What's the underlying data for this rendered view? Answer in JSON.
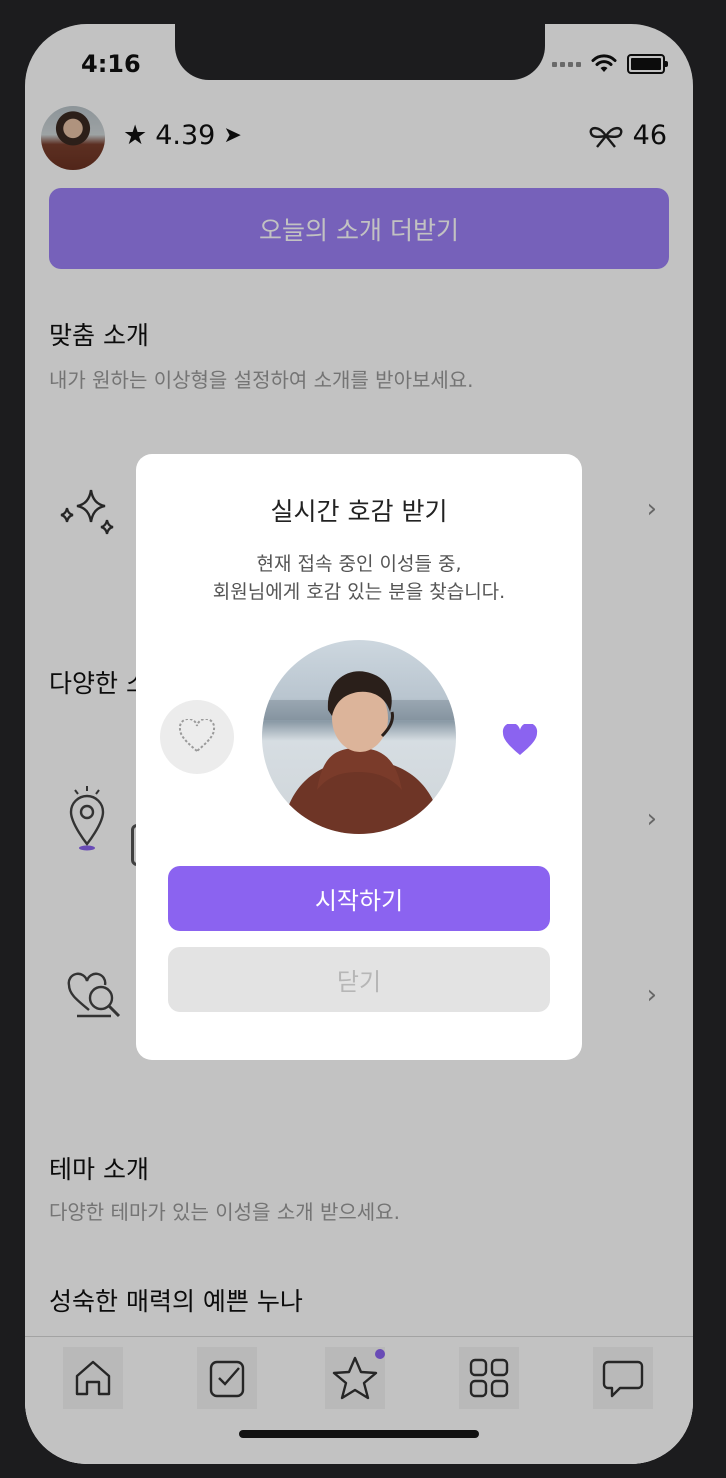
{
  "status_bar": {
    "time": "4:16"
  },
  "header": {
    "rating": "4.39",
    "ticket_count": "46"
  },
  "more_intro_button": "오늘의 소개 더받기",
  "sections": {
    "custom": {
      "title": "맞춤 소개",
      "subtitle": "내가 원하는 이상형을 설정하여 소개를 받아보세요."
    },
    "various": {
      "title_partial": "다양한 소"
    },
    "theme": {
      "title": "테마 소개",
      "subtitle": "다양한 테마가 있는 이성을 소개 받으세요."
    },
    "theme_item": {
      "title": "성숙한 매력의 예쁜 누나"
    }
  },
  "modal": {
    "title": "실시간 호감 받기",
    "desc_line1": "현재 접속 중인 이성들 중,",
    "desc_line2": "회원님에게 호감 있는 분을 찾습니다.",
    "start_button": "시작하기",
    "close_button": "닫기"
  },
  "colors": {
    "accent": "#8b63f0",
    "accent_light": "#9b80f5",
    "overlay": "rgba(0,0,0,0.24)"
  },
  "icons": {
    "tabs": [
      "home-icon",
      "check-calendar-icon",
      "star-icon",
      "grid-icon",
      "chat-icon"
    ]
  }
}
